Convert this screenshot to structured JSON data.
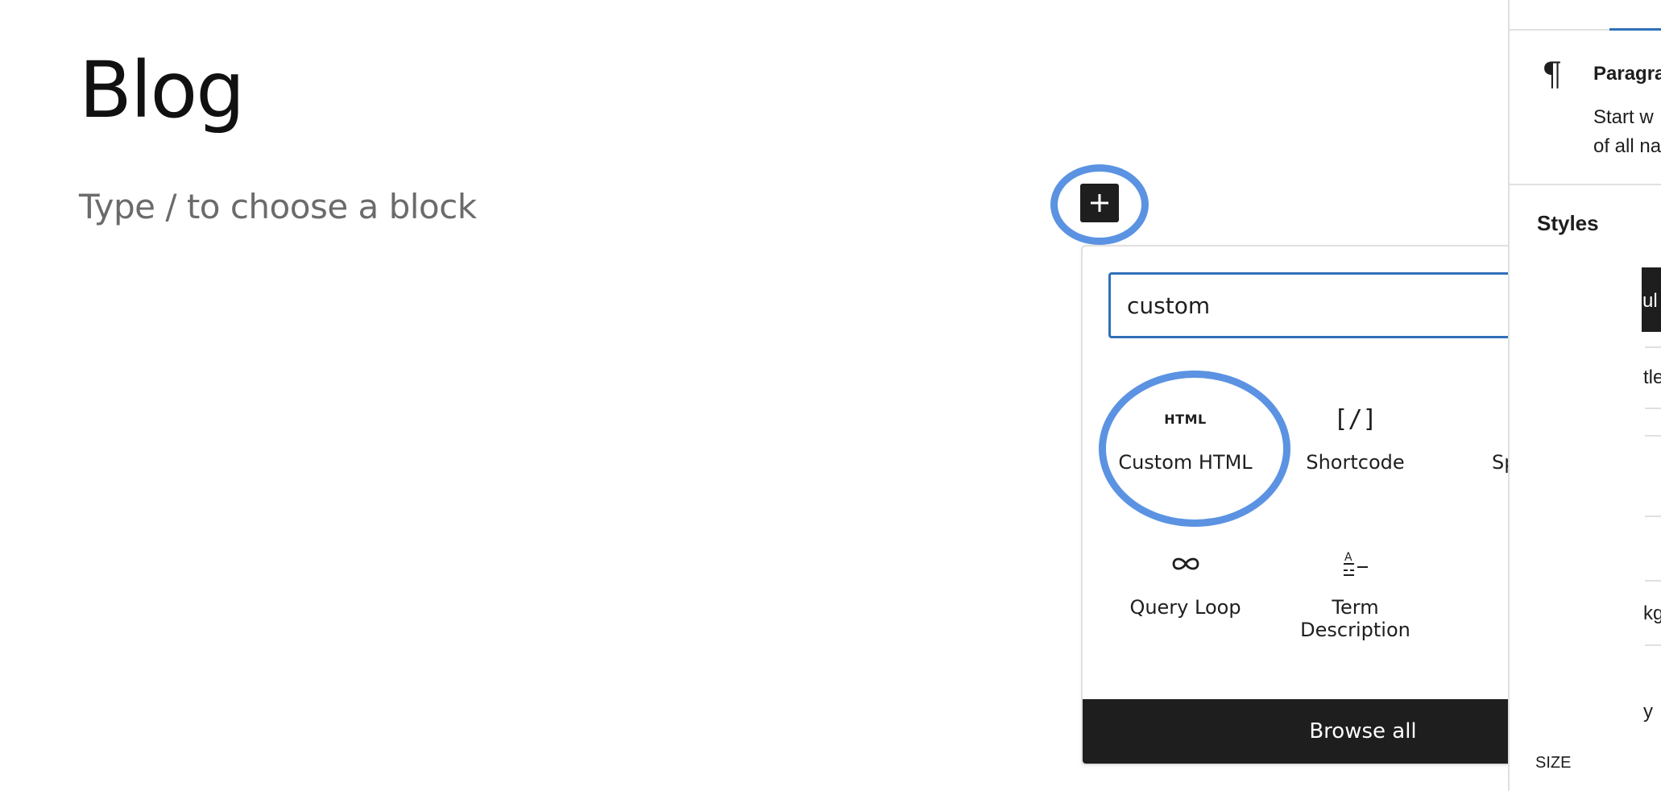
{
  "editor": {
    "title": "Blog",
    "placeholder": "Type / to choose a block"
  },
  "inserter": {
    "toggle_label": "Add block",
    "search_value": "custom",
    "blocks": [
      {
        "label": "Custom HTML",
        "icon": "html-icon",
        "icon_text": "HTML"
      },
      {
        "label": "Shortcode",
        "icon": "shortcode-icon",
        "icon_text": "[/]"
      },
      {
        "label": "Spacer",
        "icon": "spacer-icon"
      },
      {
        "label": "Query Loop",
        "icon": "query-loop-icon"
      },
      {
        "label": "Term\nDescription",
        "icon": "term-description-icon"
      }
    ],
    "browse_all": "Browse all"
  },
  "sidebar": {
    "block_title": "Paragra",
    "block_desc_line1": "Start w",
    "block_desc_line2": "of all na",
    "styles_heading": "Styles",
    "frag_dark": "ul",
    "frag_2": "tle",
    "frag_3": "kg",
    "frag_4": "y",
    "frag_5": "SIZE"
  },
  "colors": {
    "accent": "#3070b8",
    "highlight_ring": "#5b93e2",
    "dark": "#1e1e1e"
  }
}
